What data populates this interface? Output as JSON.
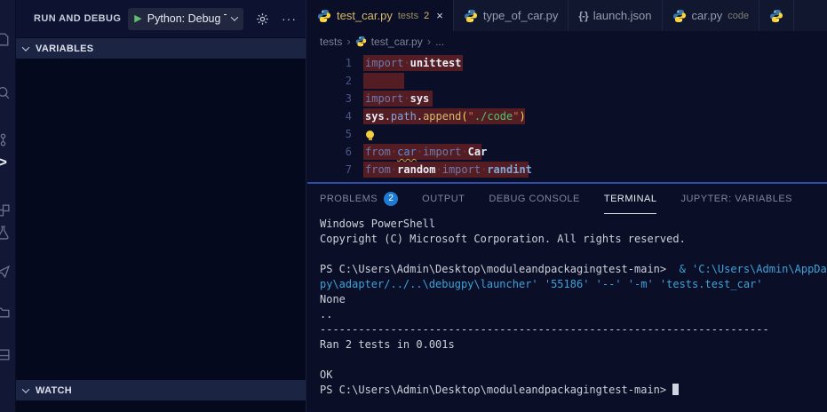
{
  "sidebar": {
    "title": "RUN AND DEBUG",
    "debug_dropdown": {
      "label": "Python: Debug T"
    },
    "sections": {
      "variables": "VARIABLES",
      "watch": "WATCH"
    },
    "more_label": "···"
  },
  "activity_bar": {
    "items": [
      "files",
      "search",
      "source-control",
      "run-and-debug",
      "extensions",
      "testing",
      "remote",
      "folder",
      "panel-layout"
    ]
  },
  "editor_tabs": [
    {
      "icon": "python",
      "label": "test_car.py",
      "description": "tests",
      "badge": "2",
      "close": "×",
      "active": true,
      "warning": true
    },
    {
      "icon": "python",
      "label": "type_of_car.py",
      "active": false
    },
    {
      "icon": "json",
      "label": "launch.json",
      "active": false
    },
    {
      "icon": "python",
      "label": "car.py",
      "description": "code",
      "active": false
    },
    {
      "icon": "python",
      "label": "",
      "active": false
    }
  ],
  "breadcrumb": {
    "items": [
      "tests",
      "test_car.py",
      "..."
    ]
  },
  "editor": {
    "lines": [
      {
        "num": "1",
        "hlw": 112,
        "tokens": [
          {
            "t": "import",
            "c": "kw"
          },
          {
            "t": " ",
            "c": "ws"
          },
          {
            "t": "unittest",
            "c": "mod"
          }
        ]
      },
      {
        "num": "2",
        "hlw": 46,
        "tokens": []
      },
      {
        "num": "3",
        "hlw": 78,
        "tokens": [
          {
            "t": "import",
            "c": "kw"
          },
          {
            "t": " ",
            "c": "ws"
          },
          {
            "t": "sys",
            "c": "mod"
          }
        ]
      },
      {
        "num": "4",
        "hlw": 182,
        "tokens": [
          {
            "t": "sys",
            "c": "mod"
          },
          {
            "t": ".",
            "c": ""
          },
          {
            "t": "path",
            "c": "prop"
          },
          {
            "t": ".",
            "c": ""
          },
          {
            "t": "append",
            "c": "fn"
          },
          {
            "t": "(",
            "c": "brk"
          },
          {
            "t": "\"",
            "c": "qt"
          },
          {
            "t": "./code",
            "c": "str"
          },
          {
            "t": "\"",
            "c": "qt"
          },
          {
            "t": ")",
            "c": "brk"
          }
        ]
      },
      {
        "num": "5",
        "hlw": 0,
        "bulb": true,
        "tokens": []
      },
      {
        "num": "6",
        "hlw": 133,
        "tokens": [
          {
            "t": "from",
            "c": "kw"
          },
          {
            "t": " ",
            "c": "ws"
          },
          {
            "t": "car",
            "c": "var sq"
          },
          {
            "t": " ",
            "c": "ws"
          },
          {
            "t": "import",
            "c": "kw"
          },
          {
            "t": " ",
            "c": "ws"
          },
          {
            "t": "Car",
            "c": "cls"
          }
        ]
      },
      {
        "num": "7",
        "hlw": 186,
        "tokens": [
          {
            "t": "from",
            "c": "kw"
          },
          {
            "t": " ",
            "c": "ws"
          },
          {
            "t": "random",
            "c": "mod"
          },
          {
            "t": " ",
            "c": "ws"
          },
          {
            "t": "import",
            "c": "kw"
          },
          {
            "t": " ",
            "c": "ws"
          },
          {
            "t": "randint",
            "c": "varb"
          }
        ]
      }
    ]
  },
  "panel": {
    "tabs": [
      {
        "label": "PROBLEMS",
        "badge": "2",
        "active": false
      },
      {
        "label": "OUTPUT",
        "active": false
      },
      {
        "label": "DEBUG CONSOLE",
        "active": false
      },
      {
        "label": "TERMINAL",
        "active": true
      },
      {
        "label": "JUPYTER: VARIABLES",
        "active": false
      }
    ],
    "terminal": {
      "lines": [
        [
          {
            "t": "Windows PowerShell"
          }
        ],
        [
          {
            "t": "Copyright (C) Microsoft Corporation. All rights reserved."
          }
        ],
        [],
        [
          {
            "t": "PS C:\\Users\\Admin\\Desktop\\moduleandpackagingtest-main>  "
          },
          {
            "t": "& 'C:\\Users\\Admin\\AppData",
            "c": "cmd"
          }
        ],
        [
          {
            "t": "py\\adapter/../..\\debugpy\\launcher' '55186' '--' '-m' 'tests.test_car'",
            "c": "cmd"
          }
        ],
        [
          {
            "t": "None"
          }
        ],
        [
          {
            "t": ".."
          }
        ],
        [
          {
            "t": "----------------------------------------------------------------------"
          }
        ],
        [
          {
            "t": "Ran 2 tests in 0.001s"
          }
        ],
        [],
        [
          {
            "t": "OK"
          }
        ],
        [
          {
            "t": "PS C:\\Users\\Admin\\Desktop\\moduleandpackagingtest-main> ",
            "cursor": true
          }
        ]
      ]
    }
  },
  "colors": {
    "editor_bg": "#0a0e27",
    "tabbar_bg": "#11172f",
    "sidebar_bg": "#05091e",
    "section_header_bg": "#1c2444",
    "line_highlight": "#541d24",
    "warning_gold": "#d7ba6a",
    "badge_blue": "#1f7ad1",
    "terminal_command_cyan": "#3fa3d8",
    "panel_border_blue": "#2d4da8",
    "play_green": "#5fbf6f"
  }
}
